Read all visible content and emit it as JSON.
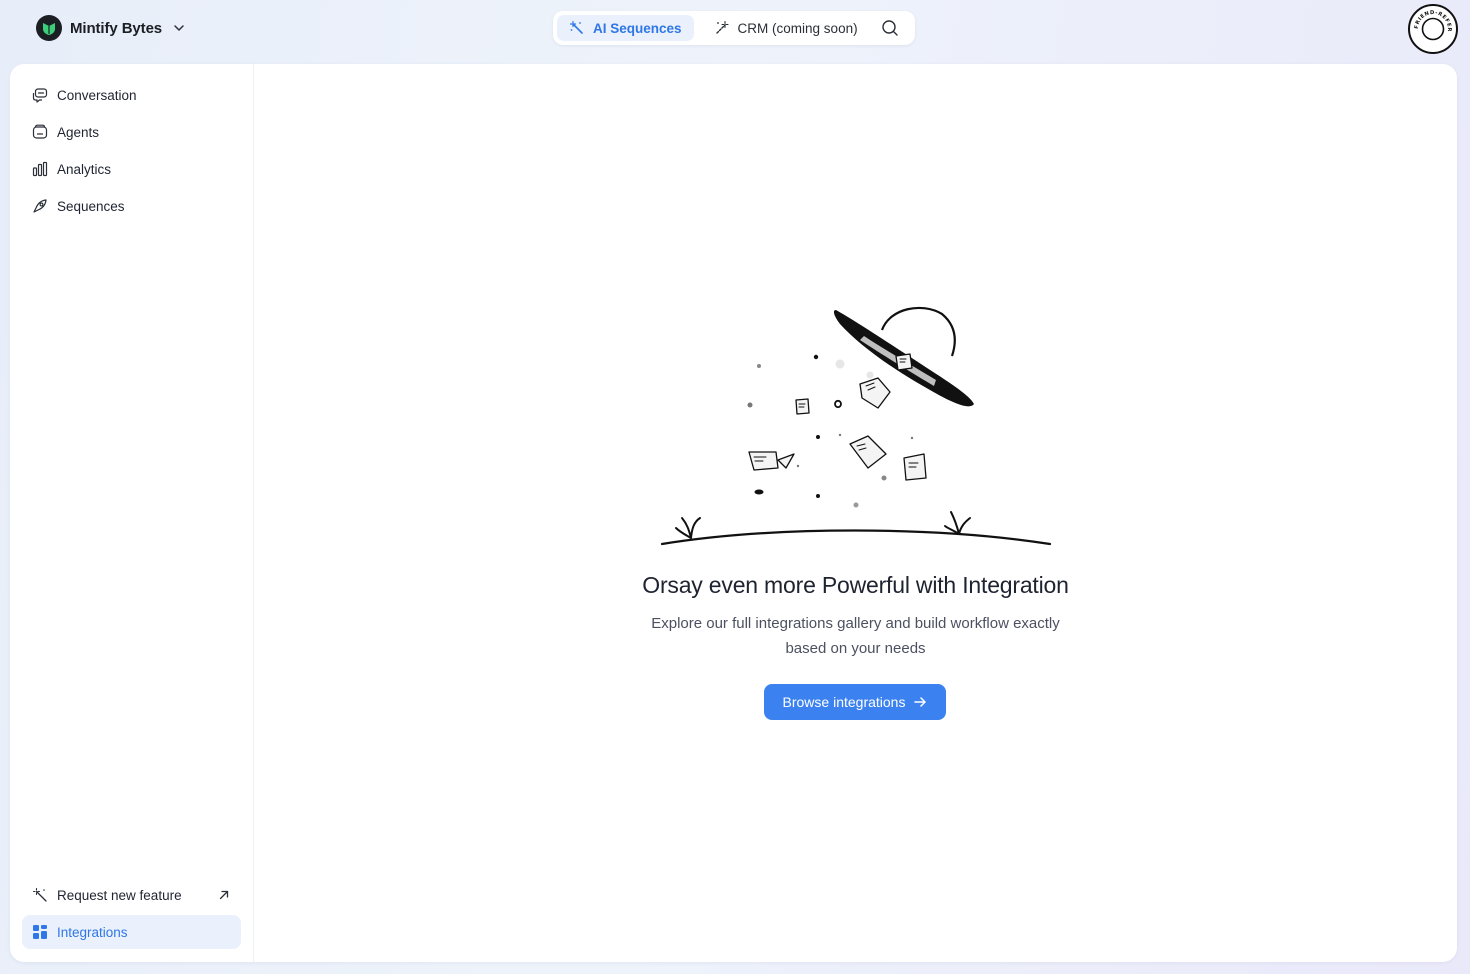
{
  "workspace": {
    "name": "Mintify Bytes",
    "logo_icon": "leaf-shield-icon",
    "logo_color": "#3ccf7a"
  },
  "topnav": {
    "tabs": [
      {
        "label": "AI Sequences",
        "icon": "magic-wand-icon",
        "active": true
      },
      {
        "label": "CRM (coming soon)",
        "icon": "sparkle-wand-icon",
        "active": false
      }
    ],
    "search_icon": "search-icon"
  },
  "badge": {
    "text": "FRIEND-REFER",
    "icon": "referral-badge-icon"
  },
  "sidebar": {
    "items": [
      {
        "label": "Conversation",
        "icon": "chat-bubbles-icon"
      },
      {
        "label": "Agents",
        "icon": "agents-icon"
      },
      {
        "label": "Analytics",
        "icon": "bar-chart-icon"
      },
      {
        "label": "Sequences",
        "icon": "sequences-icon"
      }
    ],
    "bottom": {
      "request": {
        "label": "Request new feature",
        "icon": "magic-wand-icon",
        "external_icon": "arrow-up-right-icon"
      },
      "integrations": {
        "label": "Integrations",
        "icon": "grid-icon",
        "active": true
      }
    }
  },
  "empty_state": {
    "title": "Orsay even more Powerful with Integration",
    "subtitle": "Explore our full integrations gallery and build workflow exactly based on your needs",
    "button_label": "Browse integrations",
    "button_icon": "arrow-right-icon"
  },
  "colors": {
    "accent": "#2f77e6",
    "button": "#3b82f0",
    "active_bg": "#eaf1fc"
  }
}
